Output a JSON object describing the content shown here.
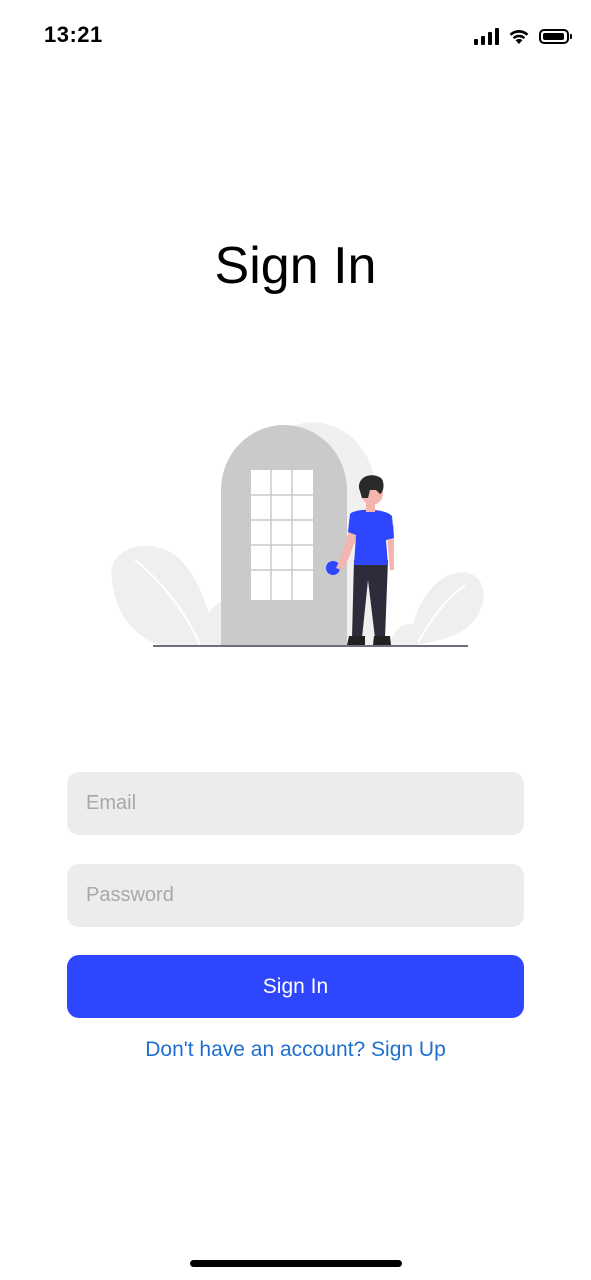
{
  "status_bar": {
    "time": "13:21"
  },
  "title": "Sign In",
  "form": {
    "email_placeholder": "Email",
    "email_value": "",
    "password_placeholder": "Password",
    "password_value": "",
    "submit_label": "Sign In"
  },
  "signup_link": "Don't have an account? Sign Up",
  "colors": {
    "primary": "#2f46ff",
    "link": "#1f6fd0",
    "input_bg": "#ececec",
    "illustration_grey": "#cacaca"
  }
}
